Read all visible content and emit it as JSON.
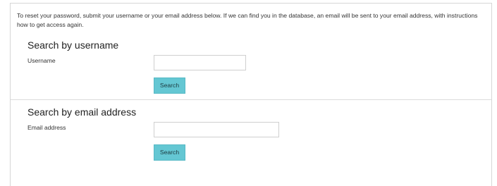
{
  "intro": {
    "text": "To reset your password, submit your username or your email address below. If we can find you in the database, an email will be sent to your email address, with instructions how to get access again."
  },
  "username_section": {
    "heading": "Search by username",
    "label": "Username",
    "value": "",
    "button": "Search"
  },
  "email_section": {
    "heading": "Search by email address",
    "label": "Email address",
    "value": "",
    "button": "Search"
  },
  "colors": {
    "button_bg": "#64c7d3",
    "border": "#d6d6d6"
  }
}
